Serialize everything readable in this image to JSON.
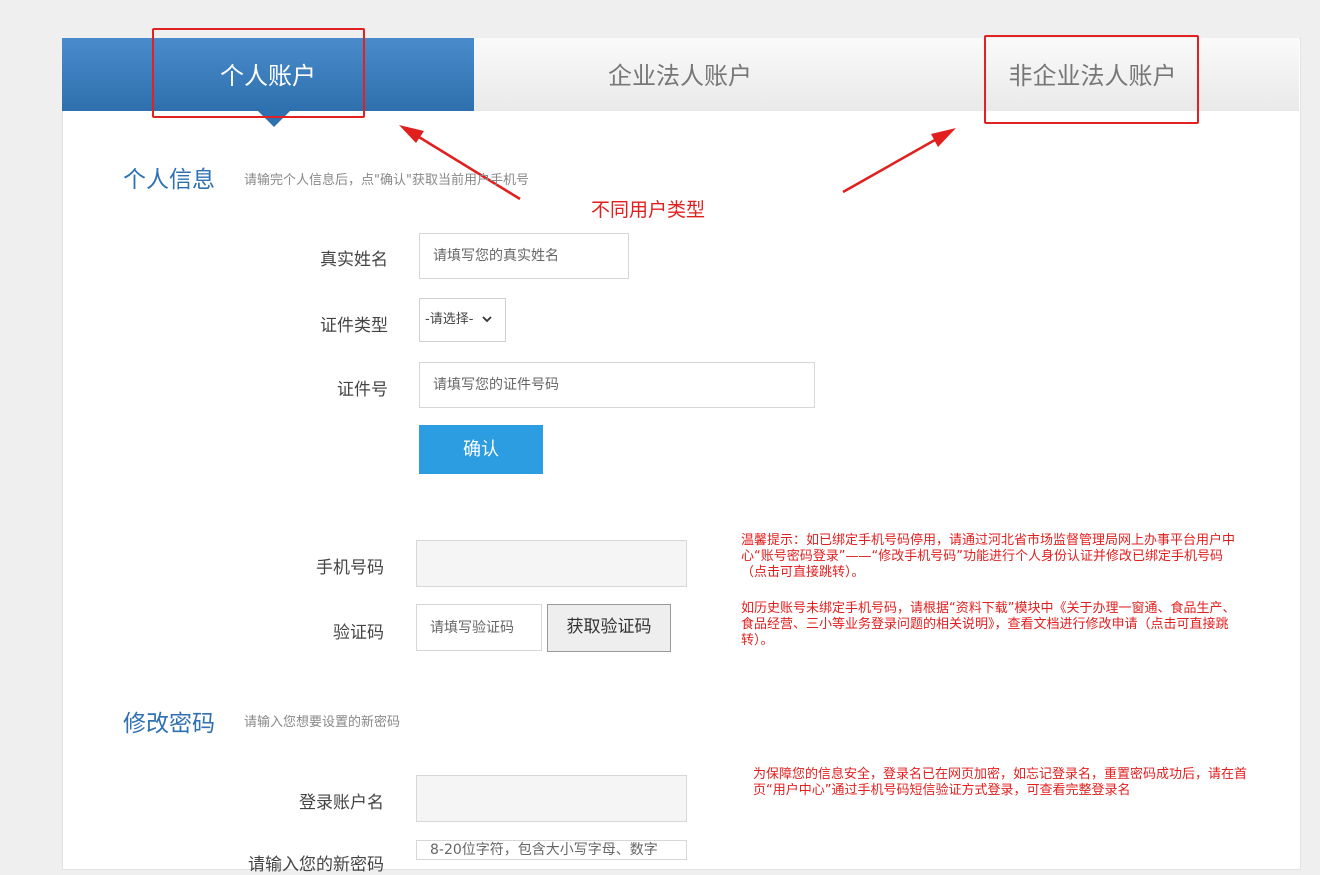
{
  "tabs": [
    {
      "label": "个人账户",
      "active": true
    },
    {
      "label": "企业法人账户",
      "active": false
    },
    {
      "label": "非企业法人账户",
      "active": false
    }
  ],
  "annotation": {
    "text": "不同用户类型"
  },
  "personal_section": {
    "title": "个人信息",
    "hint": "请输完个人信息后，点\"确认\"获取当前用户手机号"
  },
  "form": {
    "real_name_label": "真实姓名",
    "real_name_placeholder": "请填写您的真实姓名",
    "id_type_label": "证件类型",
    "id_type_selected": "-请选择-",
    "id_number_label": "证件号",
    "id_number_placeholder": "请填写您的证件号码",
    "confirm_label": "确认",
    "phone_label": "手机号码",
    "phone_value": "",
    "code_label": "验证码",
    "code_placeholder": "请填写验证码",
    "get_code_label": "获取验证码"
  },
  "notes": {
    "phone_tip": "温馨提示：如已绑定手机号码停用，请通过河北省市场监督管理局网上办事平台用户中心“账号密码登录”——“修改手机号码”功能进行个人身份认证并修改已绑定手机号码（点击可直接跳转）。",
    "history_tip": "如历史账号未绑定手机号码，请根据“资料下载”模块中《关于办理一窗通、食品生产、食品经营、三小等业务登录问题的相关说明》，查看文档进行修改申请（点击可直接跳转）。",
    "login_tip": "为保障您的信息安全，登录名已在网页加密，如忘记登录名，重置密码成功后，请在首页“用户中心”通过手机号码短信验证方式登录，可查看完整登录名"
  },
  "password_section": {
    "title": "修改密码",
    "hint": "请输入您想要设置的新密码",
    "login_name_label": "登录账户名",
    "login_name_value": "",
    "new_password_label": "请输入您的新密码",
    "new_password_placeholder": "8-20位字符，包含大小写字母、数字"
  },
  "colors": {
    "active_tab": "#3b7fbf",
    "section_title": "#2f71b2",
    "confirm_button": "#2b9de0",
    "annotation_red": "#e21f1f"
  }
}
